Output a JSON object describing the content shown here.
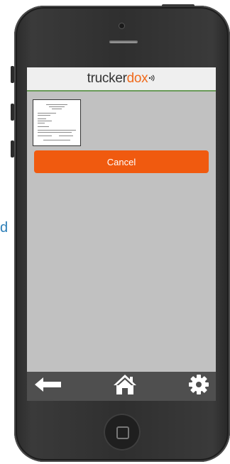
{
  "background": {
    "partial_text": "d"
  },
  "app": {
    "logo": {
      "part1": "trucker",
      "part2": "dox",
      "accent": "#f06a1b"
    },
    "header_rule_color": "#6a9b58"
  },
  "documents": [
    {
      "type": "scanned-document-thumbnail"
    }
  ],
  "buttons": {
    "cancel_label": "Cancel",
    "cancel_color": "#f05a0f"
  },
  "bottom_nav": {
    "items": [
      {
        "icon": "back-arrow-icon"
      },
      {
        "icon": "home-icon"
      },
      {
        "icon": "gear-icon"
      }
    ]
  },
  "device": {
    "type": "smartphone",
    "color": "#2f2f2f"
  }
}
